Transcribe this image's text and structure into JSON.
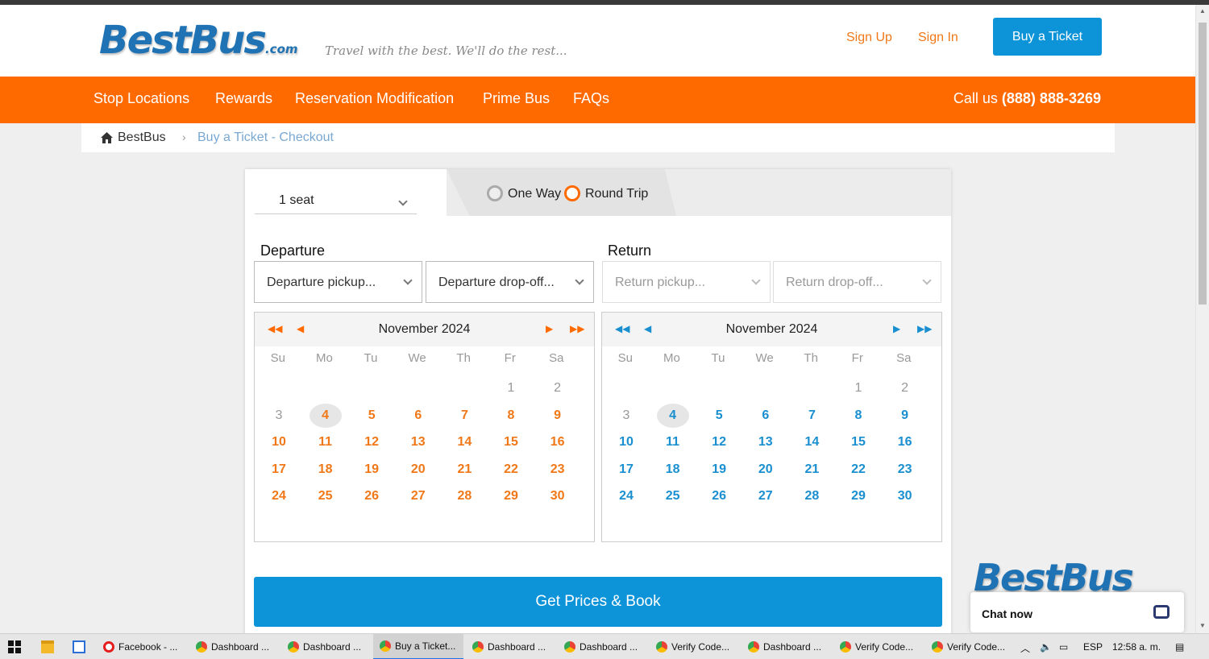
{
  "header": {
    "logo_main": "BestBus",
    "logo_suffix": ".com",
    "tagline": "Travel with the best. We'll do the rest...",
    "sign_up": "Sign Up",
    "sign_in": "Sign In",
    "buy_ticket": "Buy a Ticket"
  },
  "nav": {
    "items": [
      "Stop Locations",
      "Rewards",
      "Reservation Modification",
      "Prime Bus",
      "FAQs"
    ],
    "call_prefix": "Call us ",
    "call_number": "(888) 888-3269"
  },
  "breadcrumb": {
    "home": "BestBus",
    "separator": "›",
    "current": "Buy a Ticket - Checkout"
  },
  "booking": {
    "seats": "1 seat",
    "trip_options": [
      "One Way",
      "Round Trip"
    ],
    "selected_trip": "Round Trip",
    "departure_label": "Departure",
    "return_label": "Return",
    "departure_pickup_placeholder": "Departure pickup...",
    "departure_dropoff_placeholder": "Departure drop-off...",
    "return_pickup_placeholder": "Return pickup...",
    "return_dropoff_placeholder": "Return drop-off...",
    "cta": "Get Prices & Book"
  },
  "calendar": {
    "month_label": "November 2024",
    "weekdays": [
      "Su",
      "Mo",
      "Tu",
      "We",
      "Th",
      "Fr",
      "Sa"
    ],
    "first_weekday_index": 5,
    "days_in_month": 30,
    "today": 4,
    "disabled_days": [
      1,
      2,
      3
    ],
    "departure_color": "#f07818",
    "return_color": "#1a8fd0"
  },
  "chat": {
    "logo": "BestBus",
    "label": "Chat now"
  },
  "taskbar": {
    "apps": [
      {
        "label": "Facebook - ...",
        "icon": "opera"
      },
      {
        "label": "Dashboard ...",
        "icon": "chrome"
      },
      {
        "label": "Dashboard ...",
        "icon": "chrome"
      },
      {
        "label": "Buy a Ticket...",
        "icon": "chrome",
        "active": true
      },
      {
        "label": "Dashboard ...",
        "icon": "chrome"
      },
      {
        "label": "Dashboard ...",
        "icon": "chrome"
      },
      {
        "label": "Verify Code...",
        "icon": "chrome"
      },
      {
        "label": "Dashboard ...",
        "icon": "chrome"
      },
      {
        "label": "Verify Code...",
        "icon": "chrome"
      },
      {
        "label": "Verify Code...",
        "icon": "chrome"
      }
    ],
    "language": "ESP",
    "time": "12:58 a. m."
  },
  "colors": {
    "orange": "#ff6a00",
    "blue": "#0d93d8"
  }
}
